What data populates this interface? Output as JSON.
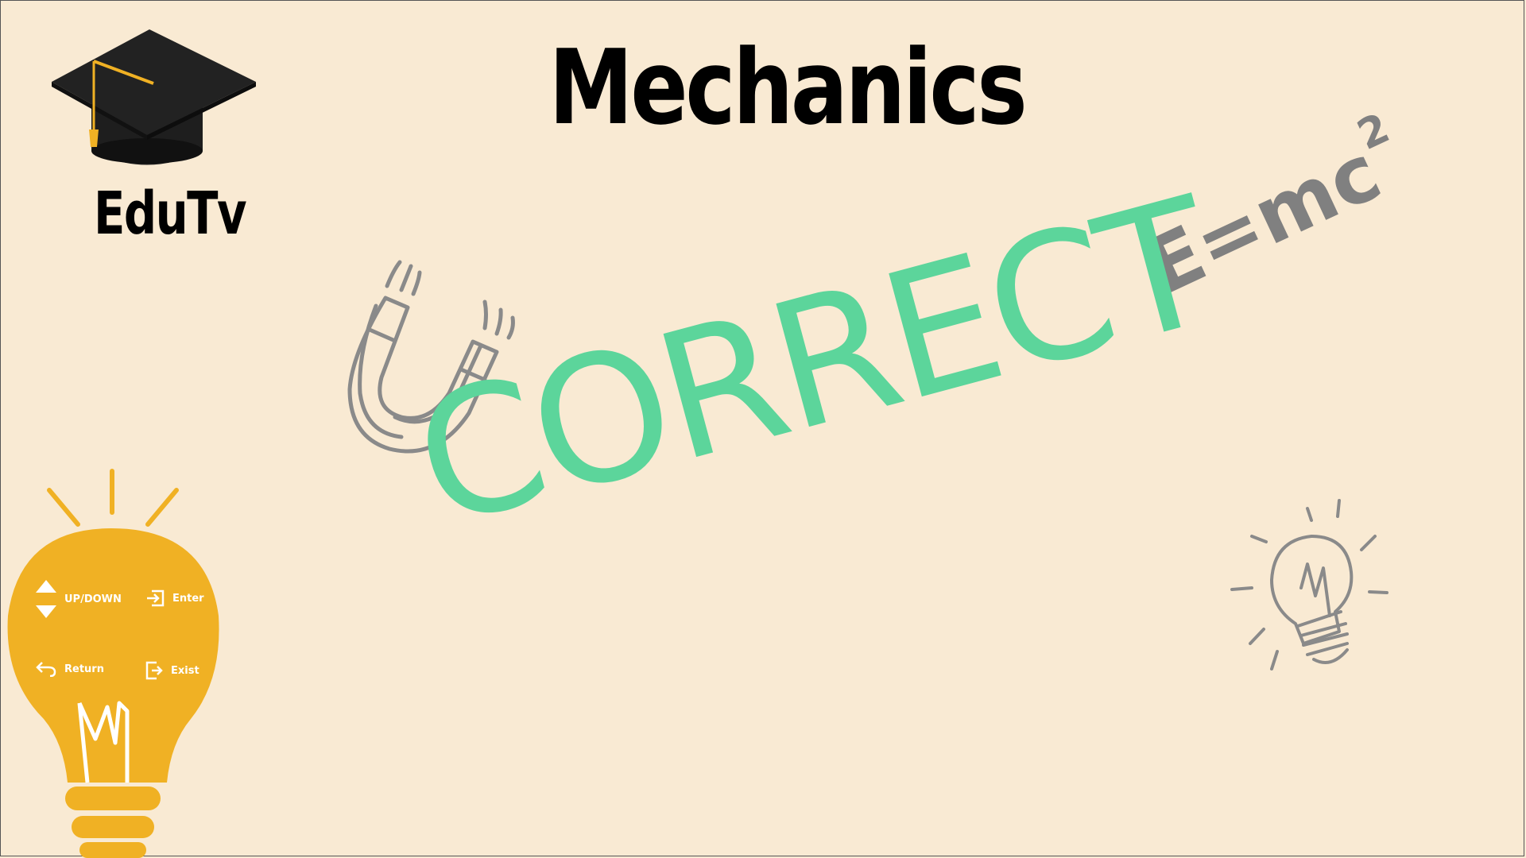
{
  "header": {
    "title": "Mechanics"
  },
  "brand": {
    "name": "EduTv",
    "icon": "graduation-cap-icon"
  },
  "feedback": {
    "result_text": "CORRECT",
    "result_color": "#5cd59b"
  },
  "decorations": {
    "formula_main": "E=mc",
    "formula_exponent": "2",
    "magnet_icon": "magnet-icon",
    "lightbulb_icon": "lightbulb-sketch-icon"
  },
  "controls": {
    "up_down_label": "UP/DOWN",
    "enter_label": "Enter",
    "return_label": "Return",
    "exit_label": "Exist",
    "panel_color": "#f0b124"
  },
  "colors": {
    "background": "#f9ead3",
    "sketch_gray": "#808080",
    "accent_green": "#5cd59b",
    "accent_yellow": "#f0b124"
  }
}
